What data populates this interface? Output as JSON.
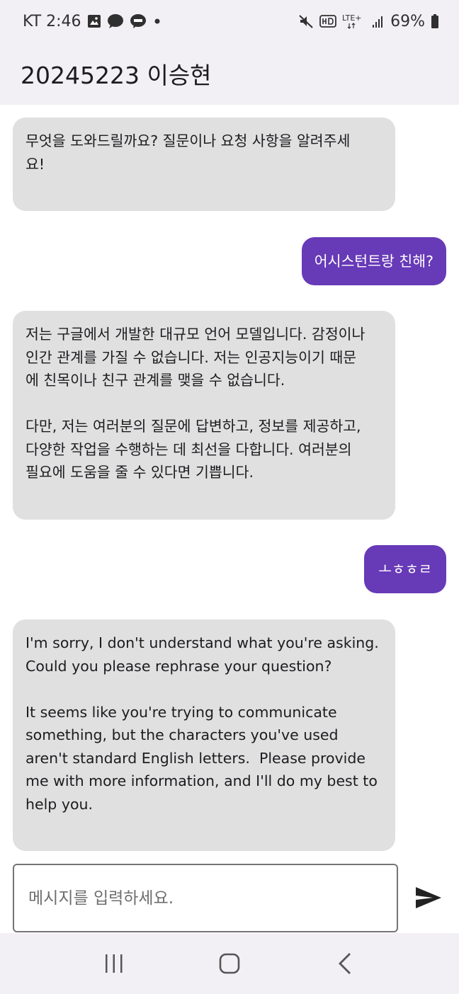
{
  "status_bar": {
    "carrier_time": "KT 2:46",
    "network": "LTE+",
    "battery": "69%",
    "left_icons": [
      "image-icon",
      "chat-bubble-icon",
      "talk-icon",
      "dot-icon"
    ],
    "right_icons": [
      "mute-icon",
      "hd-icon",
      "lte-icon",
      "signal-icon",
      "battery-icon"
    ]
  },
  "app_bar": {
    "title": "20245223 이승현"
  },
  "messages": [
    {
      "role": "bot",
      "text": "무엇을 도와드릴까요? 질문이나 요청 사항을 알려주세\n요!\n"
    },
    {
      "role": "user",
      "text": "어시스턴트랑 친해?"
    },
    {
      "role": "bot",
      "text": "저는 구글에서 개발한 대규모 언어 모델입니다. 감정이나\n인간 관계를 가질 수 없습니다. 저는 인공지능이기 때문\n에 친목이나 친구 관계를 맺을 수 없습니다.\n\n다만, 저는 여러분의 질문에 답변하고, 정보를 제공하고,\n다양한 작업을 수행하는 데 최선을 다합니다. 여러분의\n필요에 도움을 줄 수 있다면 기쁩니다.\n"
    },
    {
      "role": "user",
      "text": "ㅗㅎㅎㄹ"
    },
    {
      "role": "bot",
      "text": "I'm sorry, I don't understand what you're asking.\nCould you please rephrase your question?\n\nIt seems like you're trying to communicate\nsomething, but the characters you've used\naren't standard English letters.  Please provide\nme with more information, and I'll do my best to\nhelp you.\n"
    }
  ],
  "input": {
    "placeholder": "메시지를 입력하세요.",
    "value": ""
  },
  "send_icon": "send-icon",
  "nav_bar": {
    "icons": [
      "recent-apps-icon",
      "home-icon",
      "back-icon"
    ]
  },
  "colors": {
    "user_bubble": "#673ab7",
    "bot_bubble": "#e0e0e0",
    "app_bar": "#f2f0f5"
  }
}
